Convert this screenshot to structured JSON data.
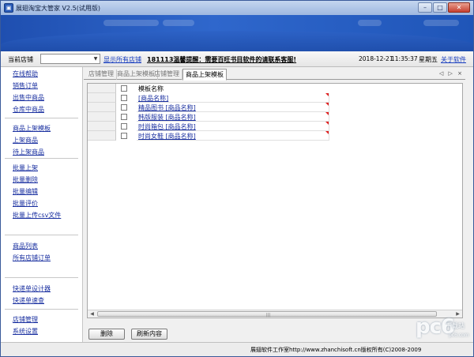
{
  "window": {
    "title": "展翅淘宝大管家 V2.5(试用版)",
    "controls": {
      "minimize": "–",
      "maximize": "□",
      "close": "✕"
    }
  },
  "toolbar": {
    "shop_label": "当前店铺",
    "shop_select_value": "",
    "show_all_shops": "显示所有店铺",
    "notice": "181113温馨提醒：需要百旺书目软件的请联系客服!",
    "date": "2018-12-21",
    "time": "11:35:37",
    "weekday": "星期五",
    "about": "关于软件"
  },
  "sidebar": {
    "items": [
      {
        "label": "在线帮助"
      },
      {
        "label": "销售订单"
      },
      {
        "label": "出售中商品"
      },
      {
        "label": "仓库中商品"
      },
      {
        "label": "商品上架模板"
      },
      {
        "label": "上架商品"
      },
      {
        "label": "待上架商品"
      },
      {
        "label": "批量上架"
      },
      {
        "label": "批量删除"
      },
      {
        "label": "批量编辑"
      },
      {
        "label": "批量评价"
      },
      {
        "label": "批量上传csv文件"
      },
      {
        "label": "商品列表"
      },
      {
        "label": "所有店铺订单"
      },
      {
        "label": "快递单设计器"
      },
      {
        "label": "快递单速查"
      },
      {
        "label": "店铺管理"
      },
      {
        "label": "系统设置"
      }
    ]
  },
  "tabs": [
    {
      "label": "店铺管理"
    },
    {
      "label": "商品上架模板"
    },
    {
      "label": "店铺管理"
    },
    {
      "label": "商品上架模板"
    }
  ],
  "tab_nav": "◁ ▷ ×",
  "grid": {
    "column_header": "模板名称",
    "rows": [
      {
        "name": "[商品名称]"
      },
      {
        "name": "精品图书 [商品名称]"
      },
      {
        "name": "韩版服装 [商品名称]"
      },
      {
        "name": "时尚箱包 [商品名称]"
      },
      {
        "name": "时尚女鞋 [商品名称]"
      }
    ]
  },
  "buttons": {
    "delete": "删除",
    "refresh": "刷新内容"
  },
  "status": {
    "copyright": "展翅软件工作室http://www.zhanchisoft.cn版权所有(C)2008-2009"
  },
  "watermark": {
    "logo": "pc6",
    "sub": "下载站",
    "domain": "pc6.com"
  }
}
